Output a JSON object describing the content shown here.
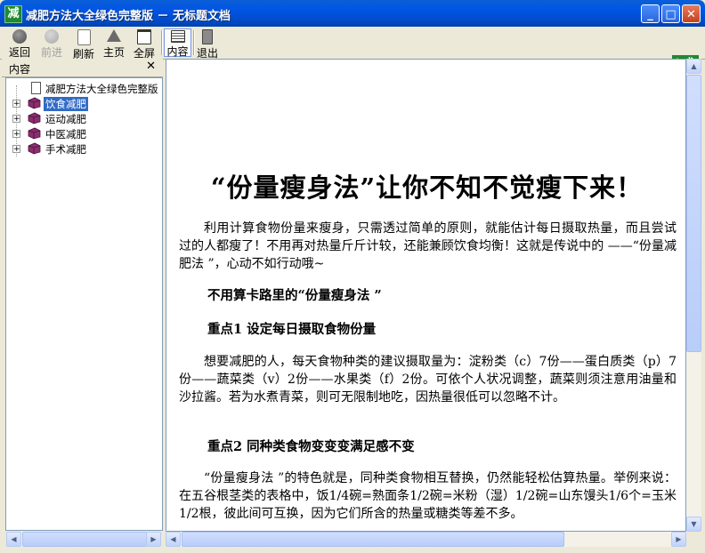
{
  "window": {
    "title": "减肥方法大全绿色完整版 － 无标题文档",
    "app_icon_char": "减",
    "minimize": "_",
    "maximize": "□",
    "close": "✕"
  },
  "toolbar": {
    "back": "返回",
    "forward": "前进",
    "refresh": "刷新",
    "home": "主页",
    "fullscreen": "全屏",
    "contents": "内容",
    "exit": "退出",
    "brand_char": "减"
  },
  "sidebar": {
    "title": "内容",
    "close": "✕",
    "items": [
      {
        "label": "减肥方法大全绿色完整版",
        "type": "document"
      },
      {
        "label": "饮食减肥",
        "type": "book",
        "selected": true
      },
      {
        "label": "运动减肥",
        "type": "book"
      },
      {
        "label": "中医减肥",
        "type": "book"
      },
      {
        "label": "手术减肥",
        "type": "book"
      }
    ]
  },
  "article": {
    "title": "“份量瘦身法”让你不知不觉瘦下来！",
    "intro": "利用计算食物份量来瘦身，只需透过简单的原则，就能估计每日摄取热量，而且尝试过的人都瘦了！不用再对热量斤斤计较，还能兼顾饮食均衡！这就是传说中的 ——“份量减肥法 ”，心动不如行动哦~",
    "subtitle": "不用算卡路里的“份量瘦身法 ”",
    "point1_heading": "重点1 设定每日摄取食物份量",
    "point1_text": "想要减肥的人，每天食物种类的建议摄取量为：淀粉类（c）7份——蛋白质类（p）7份——蔬菜类（v）2份——水果类（f）2份。可依个人状况调整，蔬菜则须注意用油量和沙拉酱。若为水煮青菜，则可无限制地吃，因热量很低可以忽略不计。",
    "point2_heading": "重点2 同种类食物变变变满足感不变",
    "point2_text": "“份量瘦身法 ”的特色就是，同种类食物相互替换，仍然能轻松估算热量。举例来说：在五谷根茎类的表格中，饭1/4碗=熟面条1/2碗=米粉（湿）1/2碗=山东馒头1/6个=玉米1/2根，彼此间可互换，因为它们所含的热量或糖类等差不多。"
  },
  "colors": {
    "titlebar": "#0054E3",
    "brand_green": "#1E8A2E",
    "selection": "#316AC5"
  }
}
